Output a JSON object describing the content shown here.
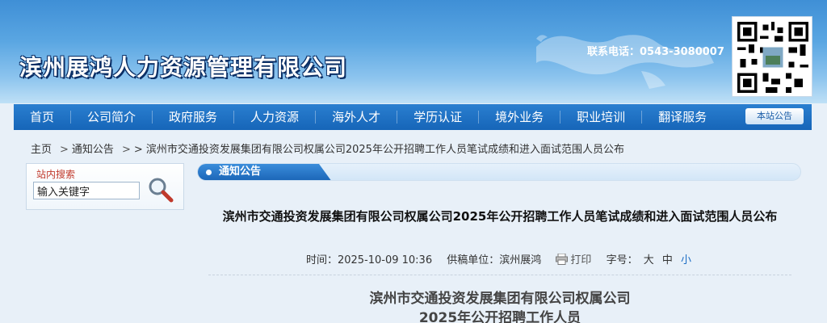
{
  "header": {
    "site_title": "滨州展鸿人力资源管理有限公司",
    "phone_label": "联系电话：0543-3080007"
  },
  "nav": {
    "items": [
      "首页",
      "公司简介",
      "政府服务",
      "人力资源",
      "海外人才",
      "学历认证",
      "境外业务",
      "职业培训",
      "翻译服务"
    ],
    "notice_button": "本站公告"
  },
  "breadcrumb": {
    "home": "主页",
    "section": "通知公告",
    "current": "> 滨州市交通投资发展集团有限公司权属公司2025年公开招聘工作人员笔试成绩和进入面试范围人员公布"
  },
  "search": {
    "title": "站内搜索",
    "input_value": "输入关键字"
  },
  "tab": {
    "label": "通知公告"
  },
  "article": {
    "title": "滨州市交通投资发展集团有限公司权属公司2025年公开招聘工作人员笔试成绩和进入面试范围人员公布",
    "time_label": "时间：",
    "time_value": "2025-10-09 10:36",
    "source_label": "供稿单位：",
    "source_value": "滨州展鸿",
    "print_label": "打印",
    "font_size_label": "字号：",
    "size_large": "大",
    "size_medium": "中",
    "size_small": "小",
    "doc_heading_line1": "滨州市交通投资发展集团有限公司权属公司",
    "doc_heading_line2": "2025年公开招聘工作人员"
  },
  "colors": {
    "nav_bg": "#1a6cc4",
    "header_bg": "#4a9ade",
    "accent_red": "#c0392b",
    "active_size": "#1a6cc4"
  }
}
